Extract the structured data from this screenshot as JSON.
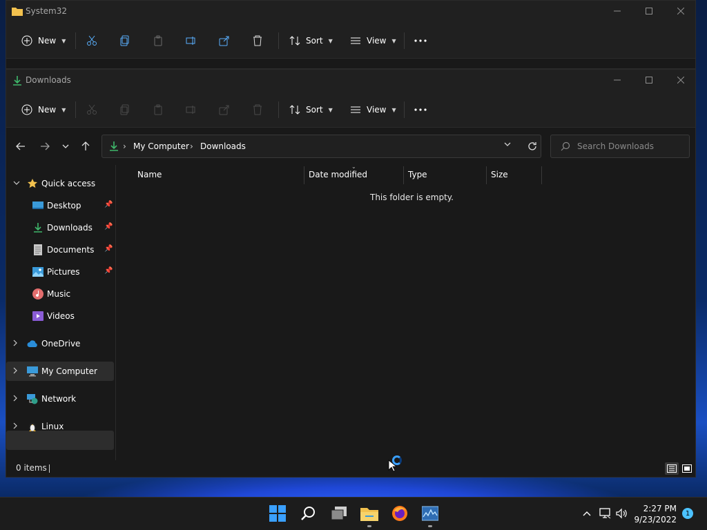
{
  "background_window": {
    "title": "System32",
    "toolbar": {
      "new_label": "New",
      "sort_label": "Sort",
      "view_label": "View"
    }
  },
  "window": {
    "title": "Downloads",
    "toolbar": {
      "new_label": "New",
      "sort_label": "Sort",
      "view_label": "View"
    },
    "address": {
      "breadcrumb": [
        "My Computer",
        "Downloads"
      ]
    },
    "search": {
      "placeholder": "Search Downloads"
    },
    "sidebar": {
      "quick_access": "Quick access",
      "quick_items": [
        {
          "label": "Desktop",
          "icon": "desktop-icon",
          "pinned": true
        },
        {
          "label": "Downloads",
          "icon": "download-icon",
          "pinned": true
        },
        {
          "label": "Documents",
          "icon": "document-icon",
          "pinned": true
        },
        {
          "label": "Pictures",
          "icon": "pictures-icon",
          "pinned": true
        },
        {
          "label": "Music",
          "icon": "music-icon",
          "pinned": false
        },
        {
          "label": "Videos",
          "icon": "videos-icon",
          "pinned": false
        }
      ],
      "roots": [
        {
          "label": "OneDrive",
          "icon": "cloud-icon"
        },
        {
          "label": "My Computer",
          "icon": "computer-icon",
          "selected": true
        },
        {
          "label": "Network",
          "icon": "network-icon"
        },
        {
          "label": "Linux",
          "icon": "linux-icon"
        }
      ]
    },
    "columns": [
      "Name",
      "Date modified",
      "Type",
      "Size"
    ],
    "empty_message": "This folder is empty.",
    "status": {
      "item_count": "0 items"
    }
  },
  "taskbar": {
    "time": "2:27 PM",
    "date": "9/23/2022",
    "notification_count": "1"
  },
  "colors": {
    "accent": "#4cc2ff",
    "download_green": "#3fb86b",
    "folder_yellow": "#f2c14e"
  }
}
